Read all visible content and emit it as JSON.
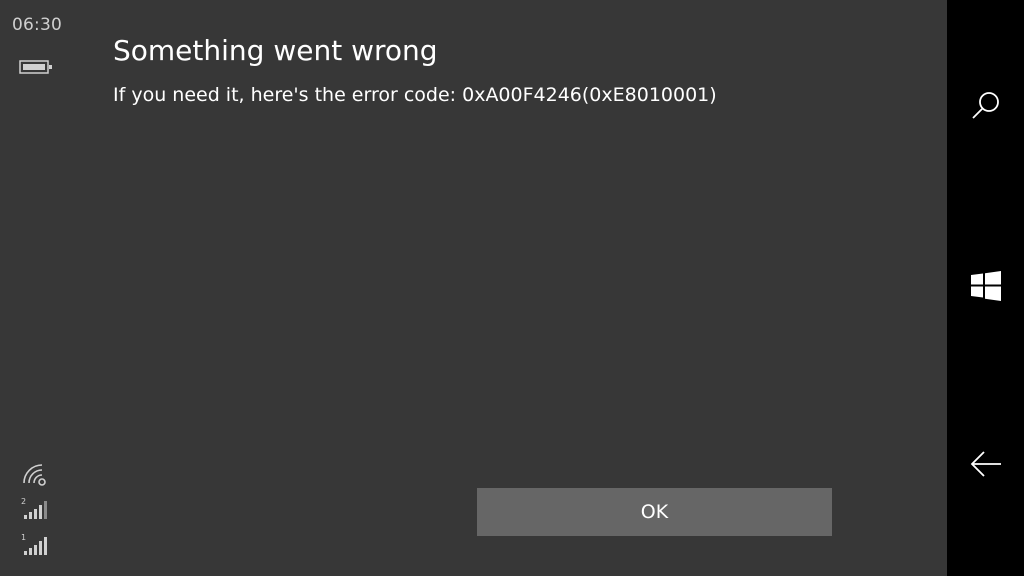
{
  "status_bar": {
    "time": "06:30",
    "sim_labels": [
      "2",
      "1"
    ],
    "icons": [
      "battery-icon",
      "wifi-icon",
      "signal-sim2-icon",
      "signal-sim1-icon"
    ]
  },
  "dialog": {
    "title": "Something went wrong",
    "message": "If you need it, here's the error code: 0xA00F4246(0xE8010001)",
    "ok_label": "OK"
  },
  "nav_bar": {
    "icons": [
      "search-icon",
      "windows-start-icon",
      "back-arrow-icon"
    ]
  },
  "colors": {
    "background": "#373737",
    "nav_bar": "#000000",
    "button": "#666666",
    "text": "#ffffff"
  }
}
